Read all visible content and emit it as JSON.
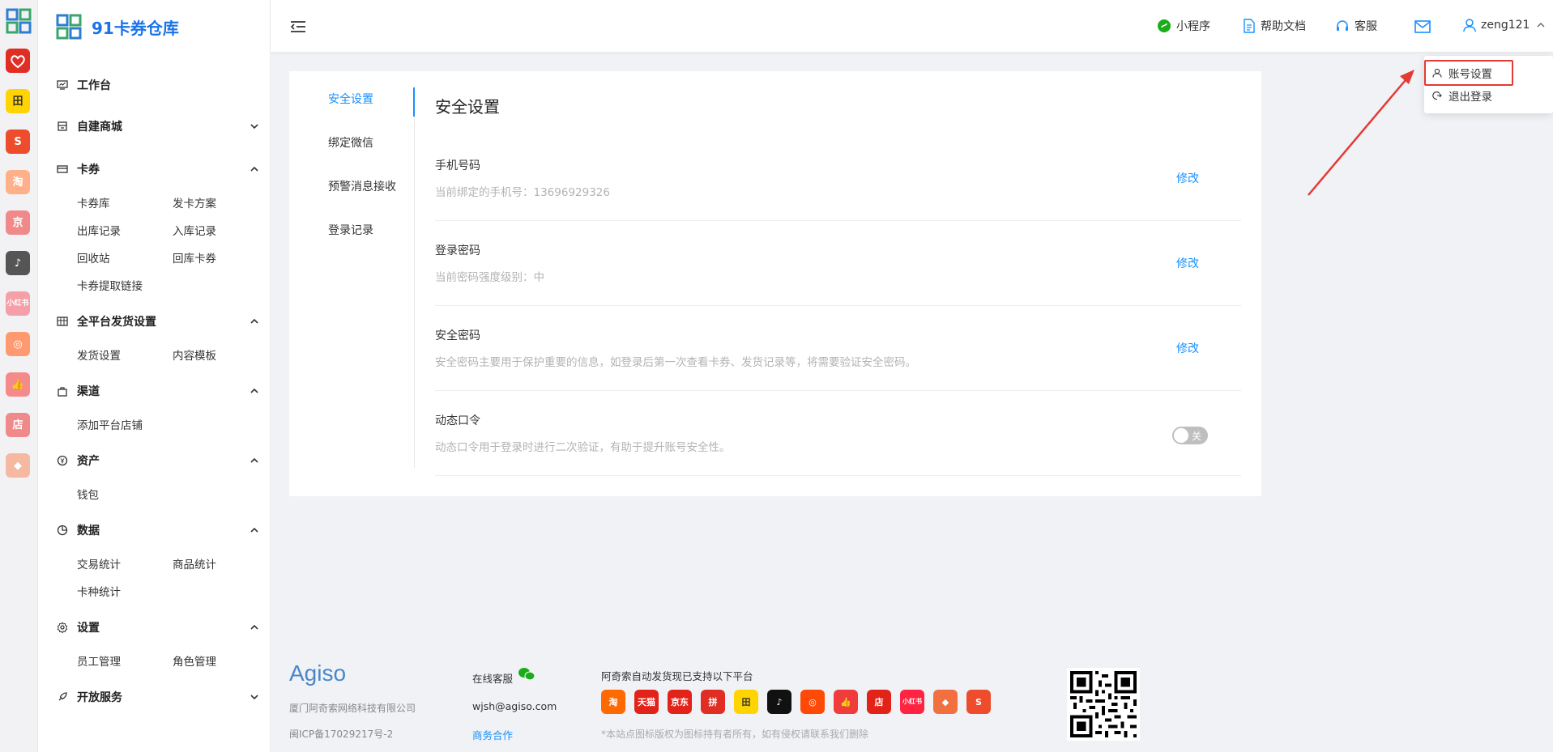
{
  "brand": {
    "title": "91卡券仓库"
  },
  "rail_icons": [
    {
      "name": "pinduoduo-icon",
      "label": "",
      "color": "#e02e24"
    },
    {
      "name": "tianmao-field-icon",
      "label": "田",
      "color": "#ffd400"
    },
    {
      "name": "shopee-icon",
      "label": "S",
      "color": "#ee4d2d"
    },
    {
      "name": "taobao-icon",
      "label": "淘",
      "color": "#ffb08a"
    },
    {
      "name": "jd-icon",
      "label": "京",
      "color": "#f08a8a"
    },
    {
      "name": "douyin-icon",
      "label": "♪",
      "color": "#555555"
    },
    {
      "name": "xiaohongshu-icon",
      "label": "小红书",
      "color": "#f5a0a8"
    },
    {
      "name": "kuaishou-icon",
      "label": "◎",
      "color": "#ff9a70"
    },
    {
      "name": "thumbs-up-icon",
      "label": "👍",
      "color": "#f58a8a"
    },
    {
      "name": "store-icon",
      "label": "店",
      "color": "#f08a8a"
    },
    {
      "name": "shop-bag-icon",
      "label": "◆",
      "color": "#f5b8a0"
    }
  ],
  "menu": {
    "workbench": "工作台",
    "mall": "自建商城",
    "coupon": "卡券",
    "coupon_items": [
      "卡券库",
      "发卡方案",
      "出库记录",
      "入库记录",
      "回收站",
      "回库卡券",
      "卡券提取链接"
    ],
    "delivery": "全平台发货设置",
    "delivery_items": [
      "发货设置",
      "内容模板"
    ],
    "channel": "渠道",
    "channel_items": [
      "添加平台店铺"
    ],
    "assets": "资产",
    "assets_items": [
      "钱包"
    ],
    "data": "数据",
    "data_items": [
      "交易统计",
      "商品统计",
      "卡种统计"
    ],
    "settings": "设置",
    "settings_items": [
      "员工管理",
      "角色管理"
    ],
    "open": "开放服务"
  },
  "header": {
    "mini_program": "小程序",
    "help": "帮助文档",
    "service": "客服",
    "username": "zeng121"
  },
  "dropdown": {
    "account_settings": "账号设置",
    "logout": "退出登录"
  },
  "tabs": [
    "安全设置",
    "绑定微信",
    "预警消息接收",
    "登录记录"
  ],
  "page_title": "安全设置",
  "rows": [
    {
      "title": "手机号码",
      "desc": "当前绑定的手机号：13696929326",
      "action": "修改"
    },
    {
      "title": "登录密码",
      "desc": "当前密码强度级别：中",
      "action": "修改"
    },
    {
      "title": "安全密码",
      "desc": "安全密码主要用于保护重要的信息，如登录后第一次查看卡券、发货记录等，将需要验证安全密码。",
      "action": "修改"
    },
    {
      "title": "动态口令",
      "desc": "动态口令用于登录时进行二次验证，有助于提升账号安全性。",
      "action": "关"
    }
  ],
  "footer": {
    "logo": "Agiso",
    "company": "厦门阿奇索网络科技有限公司",
    "icp": "闽ICP备17029217号-2",
    "online_service": "在线客服",
    "email": "wjsh@agiso.com",
    "business": "商务合作",
    "platforms_title": "阿奇索自动发货现已支持以下平台",
    "notice": "*本站点图标版权为图标持有者所有，如有侵权请联系我们删除",
    "platforms": [
      {
        "name": "taobao",
        "label": "淘",
        "color": "#ff6a00"
      },
      {
        "name": "tmall",
        "label": "天猫",
        "color": "#e2231a"
      },
      {
        "name": "jd",
        "label": "京东",
        "color": "#e2231a"
      },
      {
        "name": "pinduoduo",
        "label": "拼",
        "color": "#e02e24"
      },
      {
        "name": "tianmao-field",
        "label": "田",
        "color": "#ffd400"
      },
      {
        "name": "douyin",
        "label": "♪",
        "color": "#111111"
      },
      {
        "name": "kuaishou",
        "label": "◎",
        "color": "#ff4906"
      },
      {
        "name": "thumbs",
        "label": "👍",
        "color": "#f03c3c"
      },
      {
        "name": "store",
        "label": "店",
        "color": "#e2231a"
      },
      {
        "name": "xiaohongshu",
        "label": "小红书",
        "color": "#ff2442"
      },
      {
        "name": "shop-bag",
        "label": "◆",
        "color": "#f26f3f"
      },
      {
        "name": "shopee",
        "label": "S",
        "color": "#ee4d2d"
      }
    ]
  },
  "colors": {
    "accent": "#1890ff",
    "brand": "#1a73e8",
    "highlight": "#e53935"
  }
}
